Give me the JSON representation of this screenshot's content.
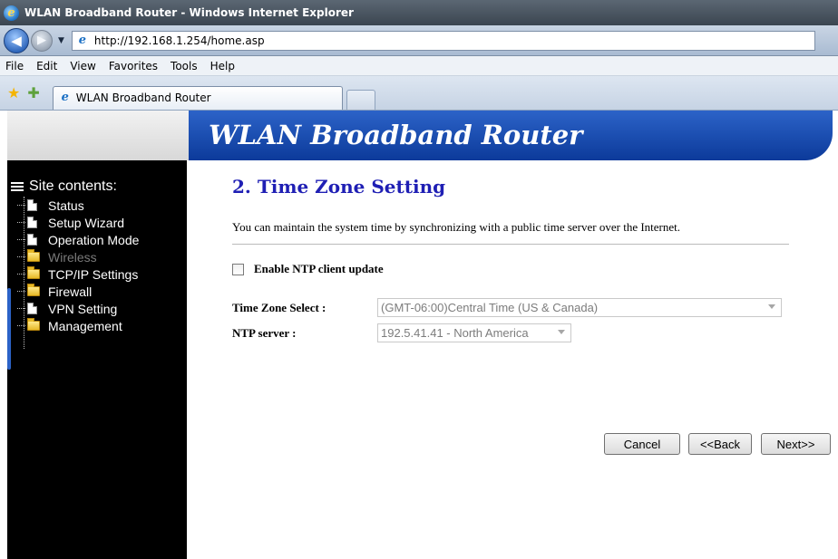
{
  "browser": {
    "window_title": "WLAN Broadband Router - Windows Internet Explorer",
    "url": "http://192.168.1.254/home.asp",
    "menu": [
      "File",
      "Edit",
      "View",
      "Favorites",
      "Tools",
      "Help"
    ],
    "tab_title": "WLAN Broadband Router"
  },
  "banner": {
    "title": "WLAN Broadband Router"
  },
  "sidebar": {
    "header": "Site contents:",
    "items": [
      {
        "label": "Status",
        "icon": "document-icon",
        "disabled": false
      },
      {
        "label": "Setup Wizard",
        "icon": "document-icon",
        "disabled": false
      },
      {
        "label": "Operation Mode",
        "icon": "document-icon",
        "disabled": false
      },
      {
        "label": "Wireless",
        "icon": "folder-icon",
        "disabled": true
      },
      {
        "label": "TCP/IP Settings",
        "icon": "folder-icon",
        "disabled": false
      },
      {
        "label": "Firewall",
        "icon": "folder-icon",
        "disabled": false
      },
      {
        "label": "VPN Setting",
        "icon": "document-icon",
        "disabled": false
      },
      {
        "label": "Management",
        "icon": "folder-icon",
        "disabled": false
      }
    ]
  },
  "main": {
    "heading": "2. Time Zone Setting",
    "description": "You can maintain the system time by synchronizing with a public time server over the Internet.",
    "ntp_checkbox_label": "Enable NTP client update",
    "ntp_checked": false,
    "time_zone_label": "Time Zone Select :",
    "time_zone_value": "(GMT-06:00)Central Time (US & Canada)",
    "ntp_server_label": "NTP server :",
    "ntp_server_value": "192.5.41.41 - North America"
  },
  "buttons": {
    "cancel": "Cancel",
    "back": "<<Back",
    "next": "Next>>"
  },
  "colors": {
    "heading": "#1f1fb4",
    "banner": "#1a4fb8",
    "sidebar_bg": "#000000"
  }
}
